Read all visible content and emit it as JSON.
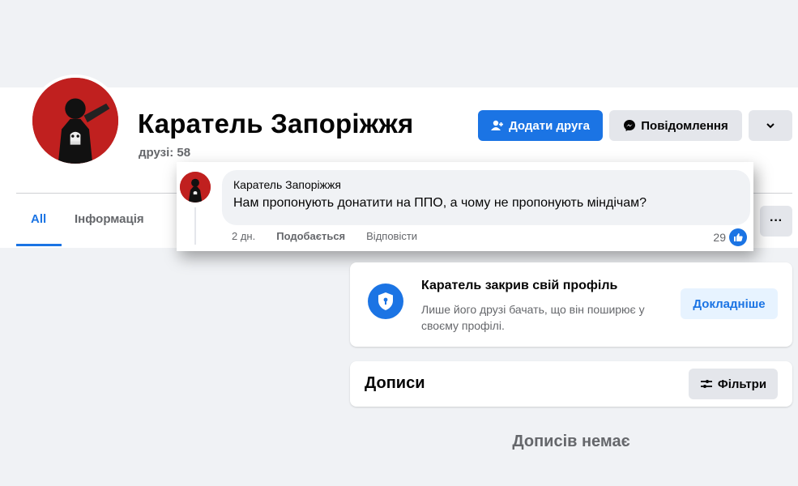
{
  "profile": {
    "name": "Каратель Запоріжжя",
    "friends_label": "друзі: 58"
  },
  "actions": {
    "add_friend": "Додати друга",
    "message": "Повідомлення",
    "more_icon": "chevron-down-icon"
  },
  "tabs": {
    "all": "All",
    "info": "Інформація",
    "more": "···"
  },
  "comment": {
    "author": "Каратель Запоріжжя",
    "text": "Нам пропонують донатити на ППО, а чому не пропонують міндічам?",
    "time": "2 дн.",
    "like_action": "Подобається",
    "reply_action": "Відповісти",
    "reaction_count": "29"
  },
  "locked_profile": {
    "title": "Каратель закрив свій профіль",
    "description": "Лише його друзі бачать, що він поширює у своєму профілі.",
    "learn_more": "Докладніше"
  },
  "posts": {
    "title": "Дописи",
    "filters": "Фільтри",
    "empty": "Дописів немає"
  },
  "colors": {
    "accent": "#1b74e4",
    "background": "#f0f2f5",
    "secondary_button": "#e4e6eb"
  }
}
